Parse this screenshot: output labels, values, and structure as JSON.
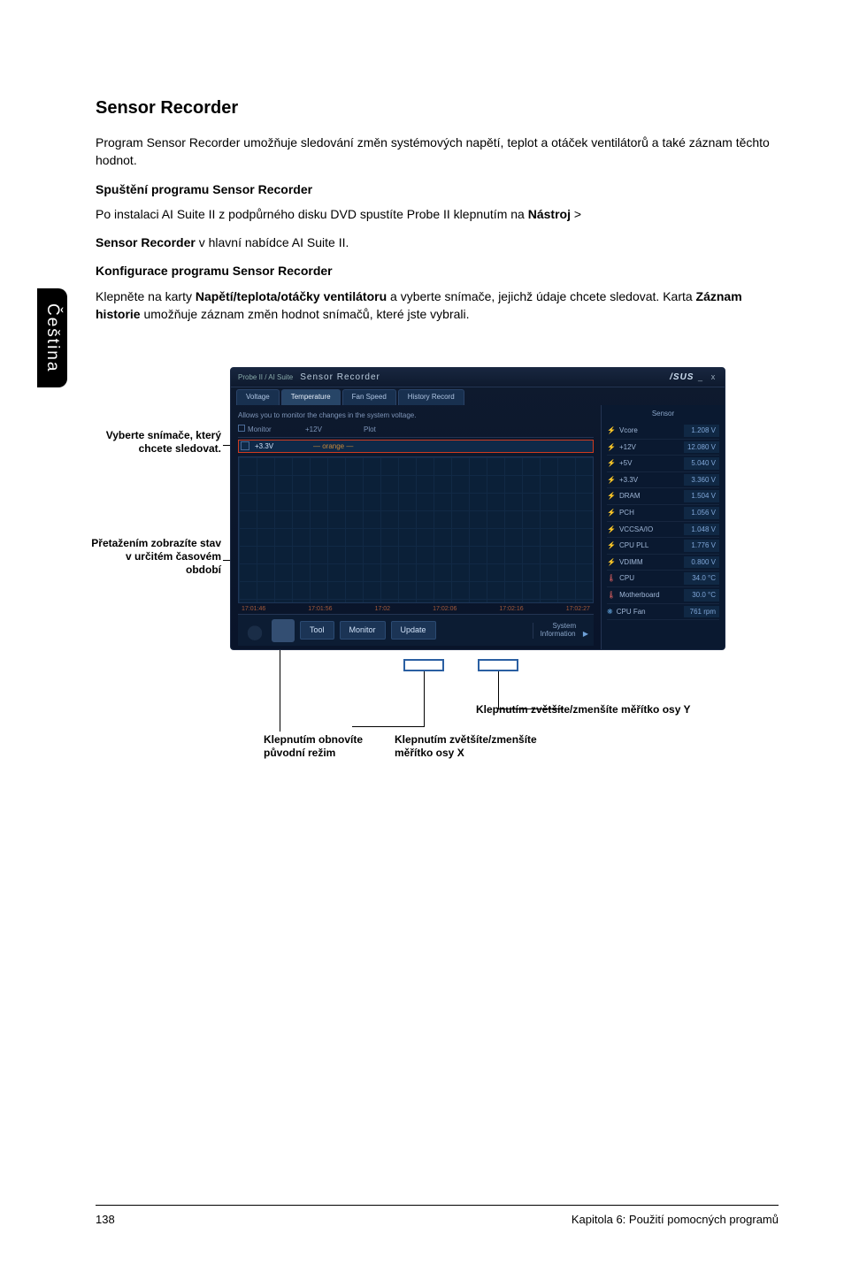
{
  "lang_tab": "Čeština",
  "title": "Sensor Recorder",
  "intro": "Program Sensor Recorder umožňuje sledování změn systémových napětí, teplot a otáček ventilátorů a také záznam těchto hodnot.",
  "launch_h": "Spuštění programu Sensor Recorder",
  "launch_p_pre": "Po instalaci AI Suite II z podpůrného disku DVD spustíte Probe II klepnutím na ",
  "launch_p_bold": "Nástroj",
  "launch_p_post": " > ",
  "launch_p2_bold": "Sensor Recorder",
  "launch_p2_post": " v hlavní nabídce AI Suite II.",
  "config_h": "Konfigurace programu Sensor Recorder",
  "config_p_pre": "Klepněte na karty ",
  "config_p_b1": "Napětí/teplota/otáčky ventilátoru",
  "config_p_mid": " a vyberte snímače, jejichž údaje chcete sledovat. Karta ",
  "config_p_b2": "Záznam historie",
  "config_p_post": " umožňuje záznam změn hodnot snímačů, které jste vybrali.",
  "callouts": {
    "select_sensor": "Vyberte snímače, který chcete sledovat.",
    "drag_period": "Přetažením zobrazíte stav v určitém časovém období",
    "reset_mode": "Klepnutím obnovíte původní režim",
    "zoom_x": "Klepnutím zvětšíte/zmenšíte měřítko osy X",
    "zoom_y": "Klepnutím zvětšíte/zmenšíte měřítko osy Y"
  },
  "app": {
    "brand": "Probe II / AI Suite",
    "title": "Sensor Recorder",
    "asus": "/SUS",
    "tabs": [
      "Voltage",
      "Temperature",
      "Fan Speed",
      "History Record"
    ],
    "subtitle": "Allows you to monitor the changes in the system voltage.",
    "col1": "Monitor",
    "col2": "+12V",
    "col3": "Plot",
    "checkrow": "+3.3V",
    "xlabels": [
      "17:01:46",
      "17:01:56",
      "17:02",
      "17:02:06",
      "17:02:16",
      "17:02:27"
    ],
    "buttons": {
      "tool": "Tool",
      "monitor": "Monitor",
      "update": "Update"
    },
    "sysinfo1": "System",
    "sysinfo2": "Information",
    "right_head": "Sensor",
    "rows": [
      {
        "icon": "bolt",
        "name": "Vcore",
        "val": "1.208 V"
      },
      {
        "icon": "bolt",
        "name": "+12V",
        "val": "12.080 V"
      },
      {
        "icon": "bolt",
        "name": "+5V",
        "val": "5.040 V"
      },
      {
        "icon": "bolt",
        "name": "+3.3V",
        "val": "3.360 V"
      },
      {
        "icon": "bolt",
        "name": "DRAM",
        "val": "1.504 V"
      },
      {
        "icon": "bolt",
        "name": "PCH",
        "val": "1.056 V"
      },
      {
        "icon": "bolt",
        "name": "VCCSA/IO",
        "val": "1.048 V"
      },
      {
        "icon": "bolt",
        "name": "CPU PLL",
        "val": "1.776 V"
      },
      {
        "icon": "bolt",
        "name": "VDIMM",
        "val": "0.800 V"
      },
      {
        "icon": "therm",
        "name": "CPU",
        "val": "34.0 °C"
      },
      {
        "icon": "therm",
        "name": "Motherboard",
        "val": "30.0 °C"
      },
      {
        "icon": "fan",
        "name": "CPU Fan",
        "val": "761 rpm"
      }
    ]
  },
  "footer": {
    "page": "138",
    "chapter": "Kapitola 6: Použití pomocných programů"
  }
}
